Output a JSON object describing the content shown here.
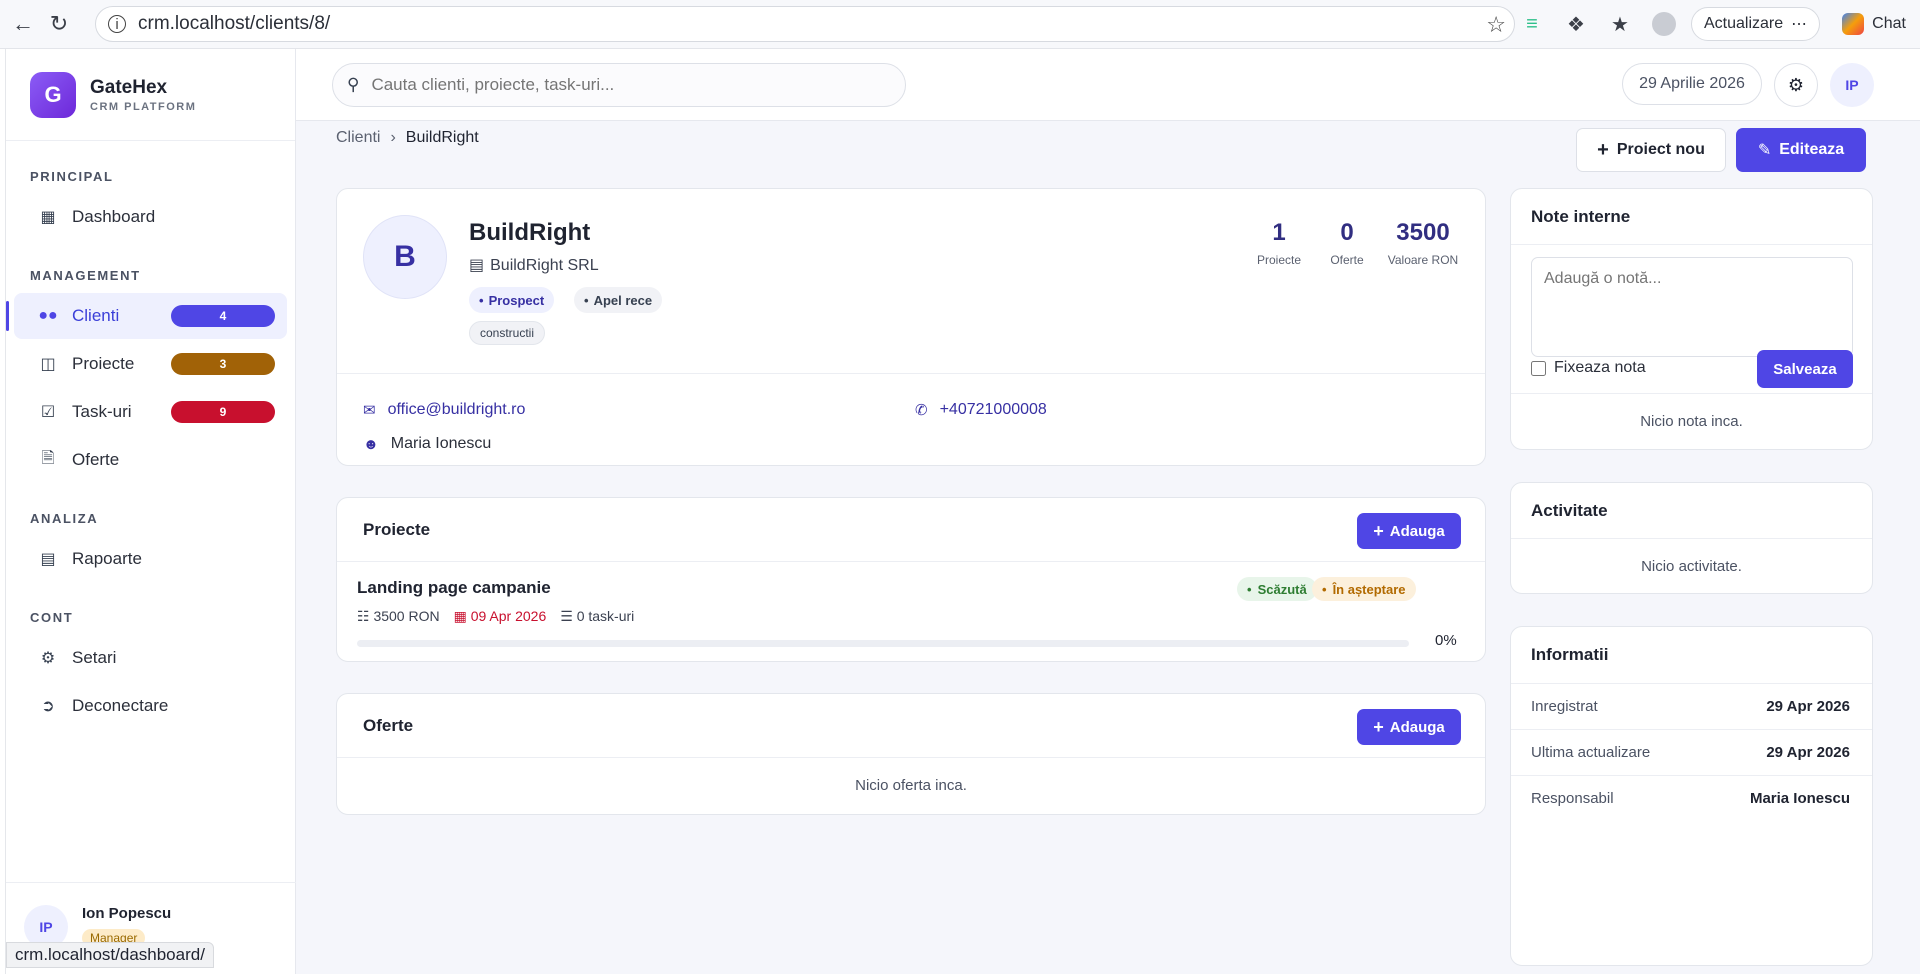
{
  "browser": {
    "url": "crm.localhost/clients/8/",
    "update_label": "Actualizare",
    "chat_label": "Chat"
  },
  "brand": {
    "name": "GateHex",
    "subtitle": "CRM PLATFORM",
    "logo_letter": "G"
  },
  "sidebar": {
    "sections": [
      {
        "label": "PRINCIPAL"
      },
      {
        "label": "MANAGEMENT"
      },
      {
        "label": "ANALIZA"
      },
      {
        "label": "CONT"
      }
    ],
    "items": [
      {
        "label": "Dashboard",
        "icon": "grid-icon"
      },
      {
        "label": "Clienti",
        "icon": "users-icon",
        "badge": "4",
        "badge_color": "#4f46e5"
      },
      {
        "label": "Proiecte",
        "icon": "folder-icon",
        "badge": "3",
        "badge_color": "#a16207"
      },
      {
        "label": "Task-uri",
        "icon": "checkbox-icon",
        "badge": "9",
        "badge_color": "#c8102e"
      },
      {
        "label": "Oferte",
        "icon": "file-icon"
      },
      {
        "label": "Rapoarte",
        "icon": "chart-icon"
      },
      {
        "label": "Setari",
        "icon": "gear-icon"
      },
      {
        "label": "Deconectare",
        "icon": "logout-icon"
      }
    ],
    "user": {
      "initials": "IP",
      "name": "Ion Popescu",
      "role": "Manager"
    }
  },
  "status_url": "crm.localhost/dashboard/",
  "topbar": {
    "search_placeholder": "Cauta clienti, proiecte, task-uri...",
    "date": "29 Aprilie 2026",
    "user_initials": "IP"
  },
  "breadcrumb": {
    "parent": "Clienti",
    "current": "BuildRight"
  },
  "actions": {
    "new_project": "Proiect nou",
    "edit": "Editeaza"
  },
  "client": {
    "initial": "B",
    "name": "BuildRight",
    "company": "BuildRight SRL",
    "tags": [
      "Prospect",
      "Apel rece"
    ],
    "industry": "constructii",
    "stats": [
      {
        "value": "1",
        "label": "Proiecte"
      },
      {
        "value": "0",
        "label": "Oferte"
      },
      {
        "value": "3500",
        "label": "Valoare RON"
      }
    ],
    "email": "office@buildright.ro",
    "phone": "+40721000008",
    "contact_person": "Maria Ionescu"
  },
  "projects": {
    "title": "Proiecte",
    "add_label": "Adauga",
    "items": [
      {
        "name": "Landing page campanie",
        "priority": "Scăzută",
        "status": "În așteptare",
        "value": "3500 RON",
        "deadline": "09 Apr 2026",
        "tasks": "0 task-uri",
        "progress_percent": 0,
        "progress_label": "0%"
      }
    ]
  },
  "offers": {
    "title": "Oferte",
    "add_label": "Adauga",
    "empty": "Nicio oferta inca."
  },
  "notes": {
    "title": "Note interne",
    "placeholder": "Adaugă o notă...",
    "pin_label": "Fixeaza nota",
    "save_label": "Salveaza",
    "empty": "Nicio nota inca."
  },
  "activity": {
    "title": "Activitate",
    "empty": "Nicio activitate."
  },
  "info": {
    "title": "Informatii",
    "rows": [
      {
        "key": "Inregistrat",
        "value": "29 Apr 2026"
      },
      {
        "key": "Ultima actualizare",
        "value": "29 Apr 2026"
      },
      {
        "key": "Responsabil",
        "value": "Maria Ionescu"
      }
    ]
  }
}
